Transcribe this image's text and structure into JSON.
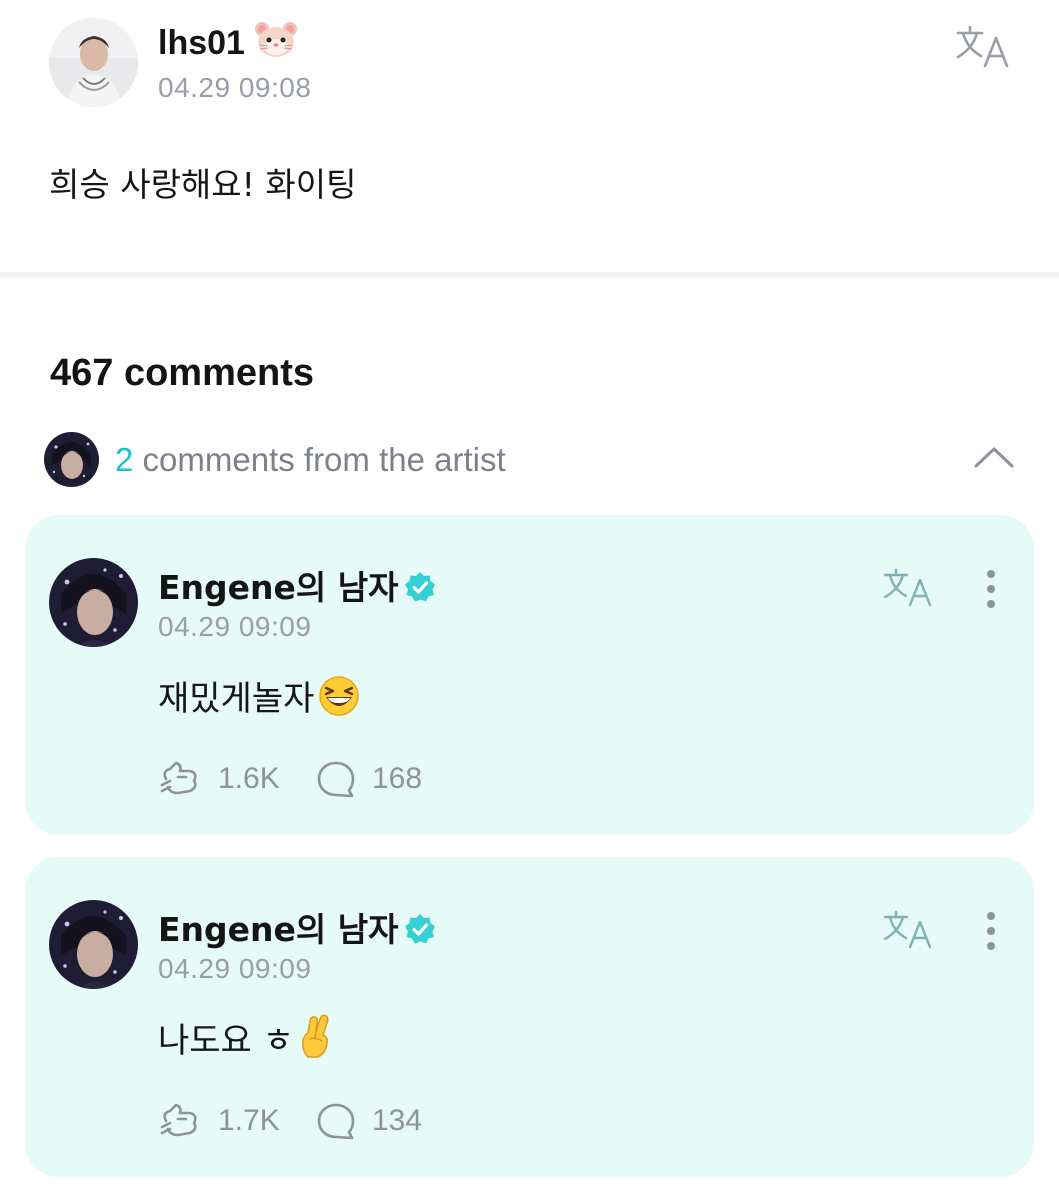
{
  "post": {
    "author": "lhs01",
    "author_emoji": "hamster-face-icon",
    "time": "04.29 09:08",
    "body": "희승 사랑해요! 화이팅"
  },
  "comments_header": {
    "count_label": "467 comments"
  },
  "artist_row": {
    "count": "2",
    "label": " comments from the artist"
  },
  "comments": [
    {
      "author": "Engene의 남자",
      "verified": true,
      "time": "04.29 09:09",
      "body": "재밌게놀자",
      "body_emoji": "grinning-squinting-face-icon",
      "likes": "1.6K",
      "replies": "168"
    },
    {
      "author": "Engene의 남자",
      "verified": true,
      "time": "04.29 09:09",
      "body": "나도요 ㅎ",
      "body_emoji": "crossed-fingers-icon",
      "likes": "1.7K",
      "replies": "134"
    }
  ],
  "colors": {
    "accent": "#19c3c6",
    "card_background": "#e6faf7",
    "muted_text": "#9a9ea6"
  }
}
